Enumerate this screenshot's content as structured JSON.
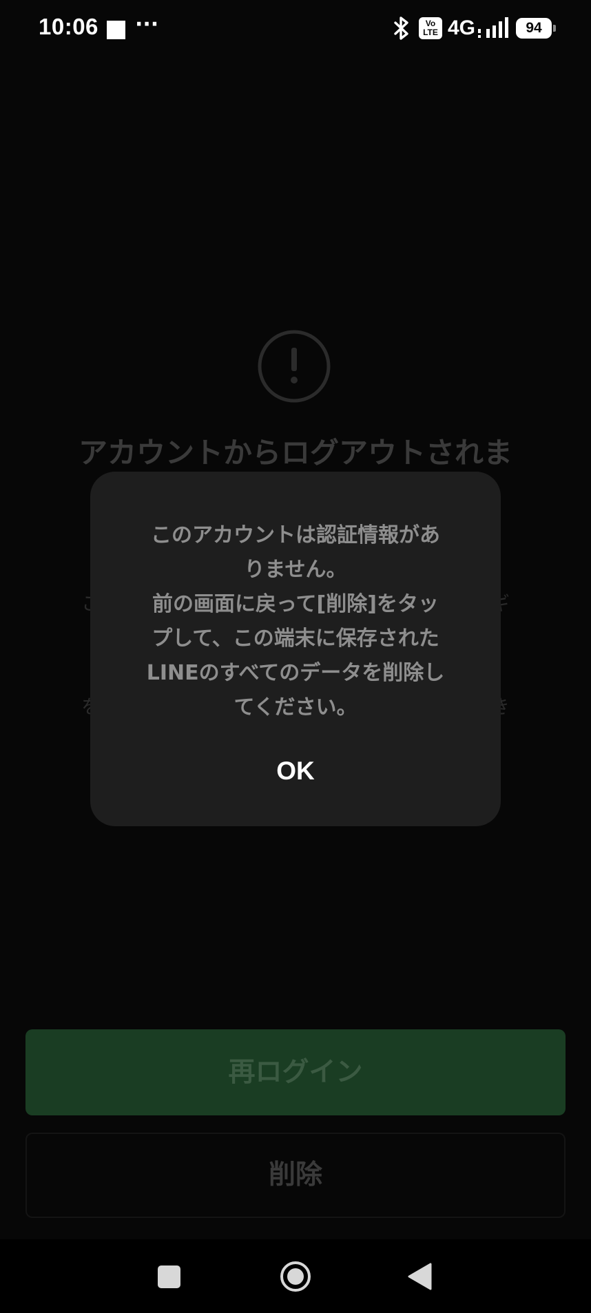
{
  "status_bar": {
    "time": "10:06",
    "more_indicator": "···",
    "volte_label_top": "Vo",
    "volte_label_bottom": "LTE",
    "network": "4G",
    "battery": "94",
    "icons": [
      "notification-square-icon",
      "bluetooth-icon",
      "volte-icon",
      "signal-icon",
      "battery-icon"
    ]
  },
  "background": {
    "icon": "warning-icon",
    "title": "アカウントからログアウトされま",
    "body_fragments": [
      "こ",
      "ギ",
      "を",
      "き"
    ]
  },
  "dialog": {
    "message_lines": [
      "このアカウントは認証情報があ",
      "りません。",
      "前の画面に戻って[削除]をタッ",
      "プして、この端末に保存された",
      "LINEのすべてのデータを削除し",
      "てください。"
    ],
    "ok_label": "OK"
  },
  "buttons": {
    "relogin_label": "再ログイン",
    "delete_label": "削除"
  },
  "nav_bar": {
    "icons": [
      "recent-apps-icon",
      "home-icon",
      "back-icon"
    ]
  },
  "colors": {
    "background": "#070707",
    "dialog": "#1e1e1e",
    "relogin_button": "#1a3d23",
    "dialog_text": "#8e8e8e",
    "ok_text": "#ffffff"
  }
}
